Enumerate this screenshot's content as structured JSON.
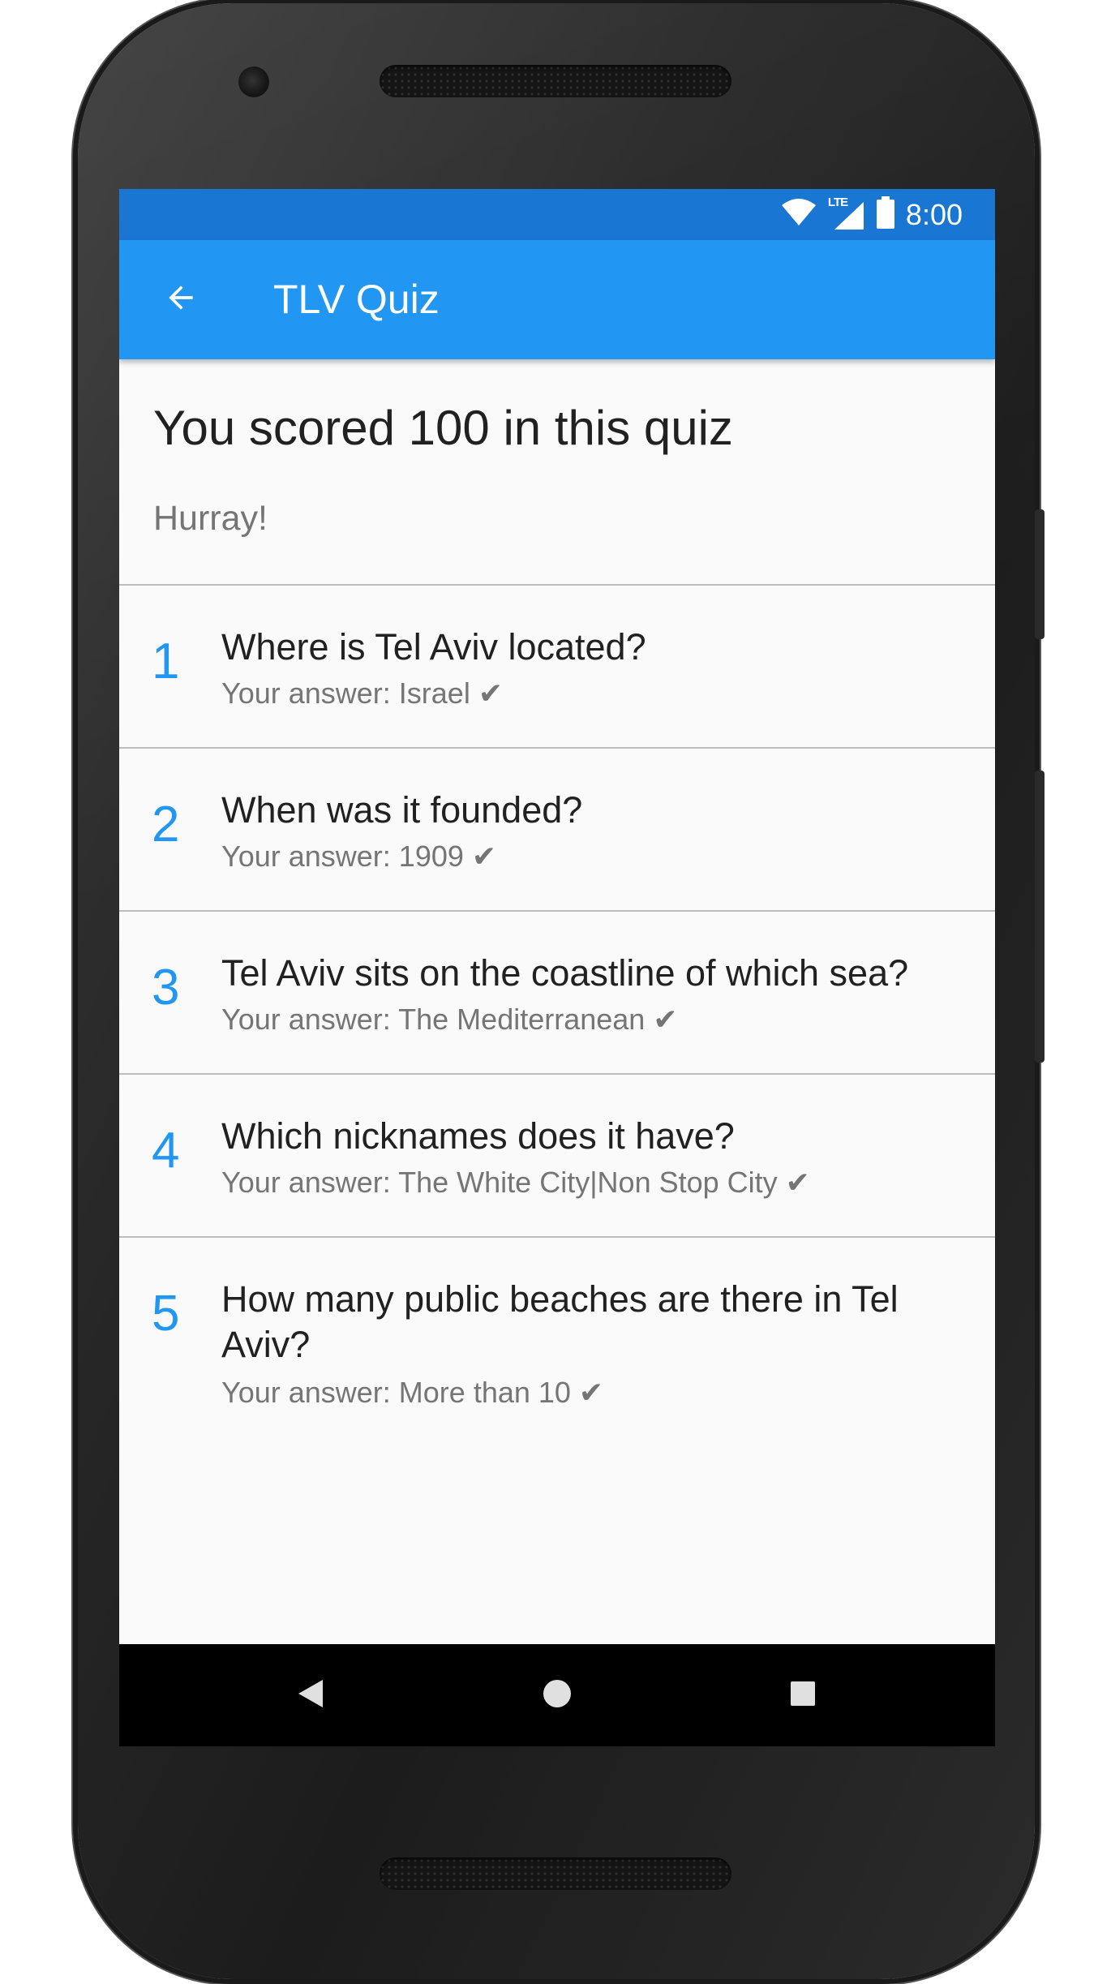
{
  "status_bar": {
    "time": "8:00",
    "network_label": "LTE",
    "icons": [
      "wifi-icon",
      "lte-signal-icon",
      "battery-icon"
    ]
  },
  "app_bar": {
    "title": "TLV Quiz",
    "back_icon": "arrow-back-icon"
  },
  "result": {
    "score_text": "You scored 100 in this quiz",
    "message": "Hurray!"
  },
  "questions": [
    {
      "number": "1",
      "question": "Where is Tel Aviv located?",
      "answer": "Your answer: Israel ✔"
    },
    {
      "number": "2",
      "question": "When was it founded?",
      "answer": "Your answer: 1909 ✔"
    },
    {
      "number": "3",
      "question": "Tel Aviv sits on the coastline of which sea?",
      "answer": "Your answer: The Mediterranean ✔"
    },
    {
      "number": "4",
      "question": "Which nicknames does it have?",
      "answer": "Your answer: The White City|Non Stop City ✔"
    },
    {
      "number": "5",
      "question": "How many public beaches are there in Tel Aviv?",
      "answer": "Your answer: More than 10 ✔"
    }
  ],
  "nav_bar": {
    "icons": [
      "nav-back-icon",
      "nav-home-icon",
      "nav-recents-icon"
    ]
  },
  "colors": {
    "status_bar": "#1976d2",
    "app_bar": "#2196f3",
    "accent_number": "#2196f3",
    "background": "#fafafa"
  }
}
